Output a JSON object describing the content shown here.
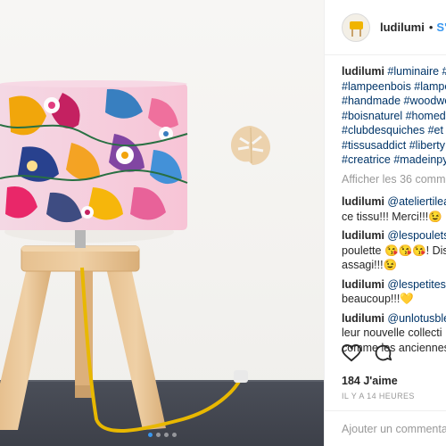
{
  "post": {
    "username": "ludilumi",
    "follow_separator": "•",
    "follow_label": "S'a",
    "caption_lines": [
      {
        "user": "ludilumi",
        "text": " #luminaire #"
      },
      {
        "text": "#lampeenbois #lampe"
      },
      {
        "text": "#handmade #woodwo"
      },
      {
        "text": "#boisnaturel #homed"
      },
      {
        "text": "#clubdesquiches #et"
      },
      {
        "text": "#tissusaddict #liberty"
      },
      {
        "text": "#creatrice #madeinpy"
      }
    ],
    "view_all_label": "Afficher les 36 comm",
    "comments": [
      {
        "user": "ludilumi",
        "mention": " @ateliertilea",
        "lines": [
          "ce tissu!!! Merci!!!😉"
        ]
      },
      {
        "user": "ludilumi",
        "mention": " @lespoulets",
        "lines": [
          "poulette 😘😘😘! Dis",
          "assagi!!!😉"
        ]
      },
      {
        "user": "ludilumi",
        "mention": " @lespetitesh",
        "lines": [
          "beaucoup!!!💛"
        ]
      },
      {
        "user": "ludilumi",
        "mention": " @unlotusble",
        "lines": [
          "leur nouvelle collecti",
          "comme les anciennes"
        ]
      }
    ],
    "likes_label": "184 J'aime",
    "time_label": "IL Y A 14 HEURES",
    "add_comment_placeholder": "Ajouter un commenta"
  },
  "icons": {
    "like": "heart-icon",
    "comment": "comment-icon"
  },
  "carousel": {
    "total": 4,
    "active_index": 0
  },
  "colors": {
    "link": "#3897f0",
    "hashtag": "#003569",
    "muted": "#999999",
    "shade_base": "#f5c9d9",
    "cord": "#e8b800"
  }
}
